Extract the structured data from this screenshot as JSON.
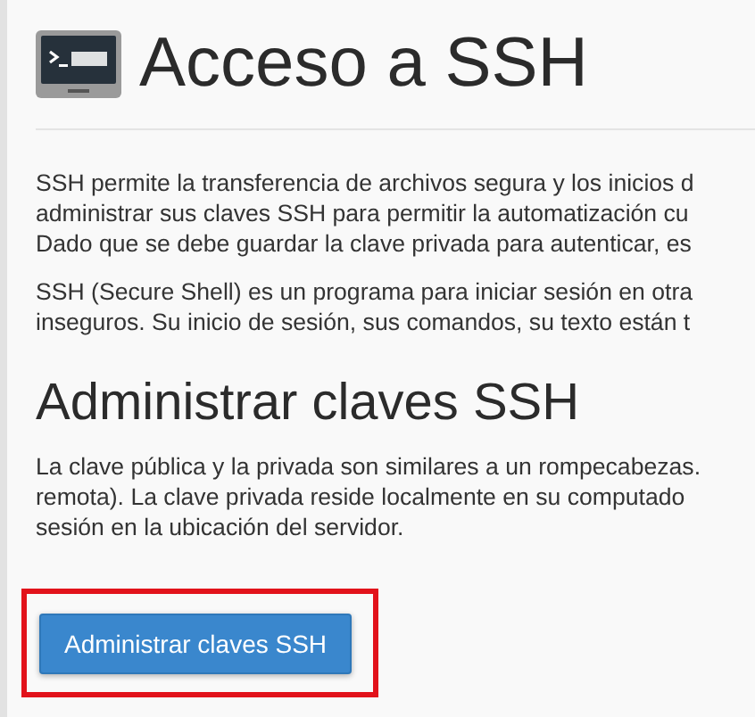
{
  "page": {
    "title": "Acceso a SSH"
  },
  "intro_paragraphs": [
    {
      "lines": [
        "SSH permite la transferencia de archivos segura y los inicios d",
        "administrar sus claves SSH para permitir la automatización cu",
        "Dado que se debe guardar la clave privada para autenticar, es"
      ]
    },
    {
      "lines": [
        "SSH (Secure Shell) es un programa para iniciar sesión en otra",
        "inseguros. Su inicio de sesión, sus comandos, su texto están t"
      ]
    }
  ],
  "section": {
    "title": "Administrar claves SSH",
    "paragraph": {
      "lines": [
        "La clave pública y la privada son similares a un rompecabezas.",
        "remota). La clave privada reside localmente en su computado",
        "sesión en la ubicación del servidor."
      ]
    },
    "button": {
      "label": "Administrar claves SSH",
      "highlighted": true
    }
  }
}
